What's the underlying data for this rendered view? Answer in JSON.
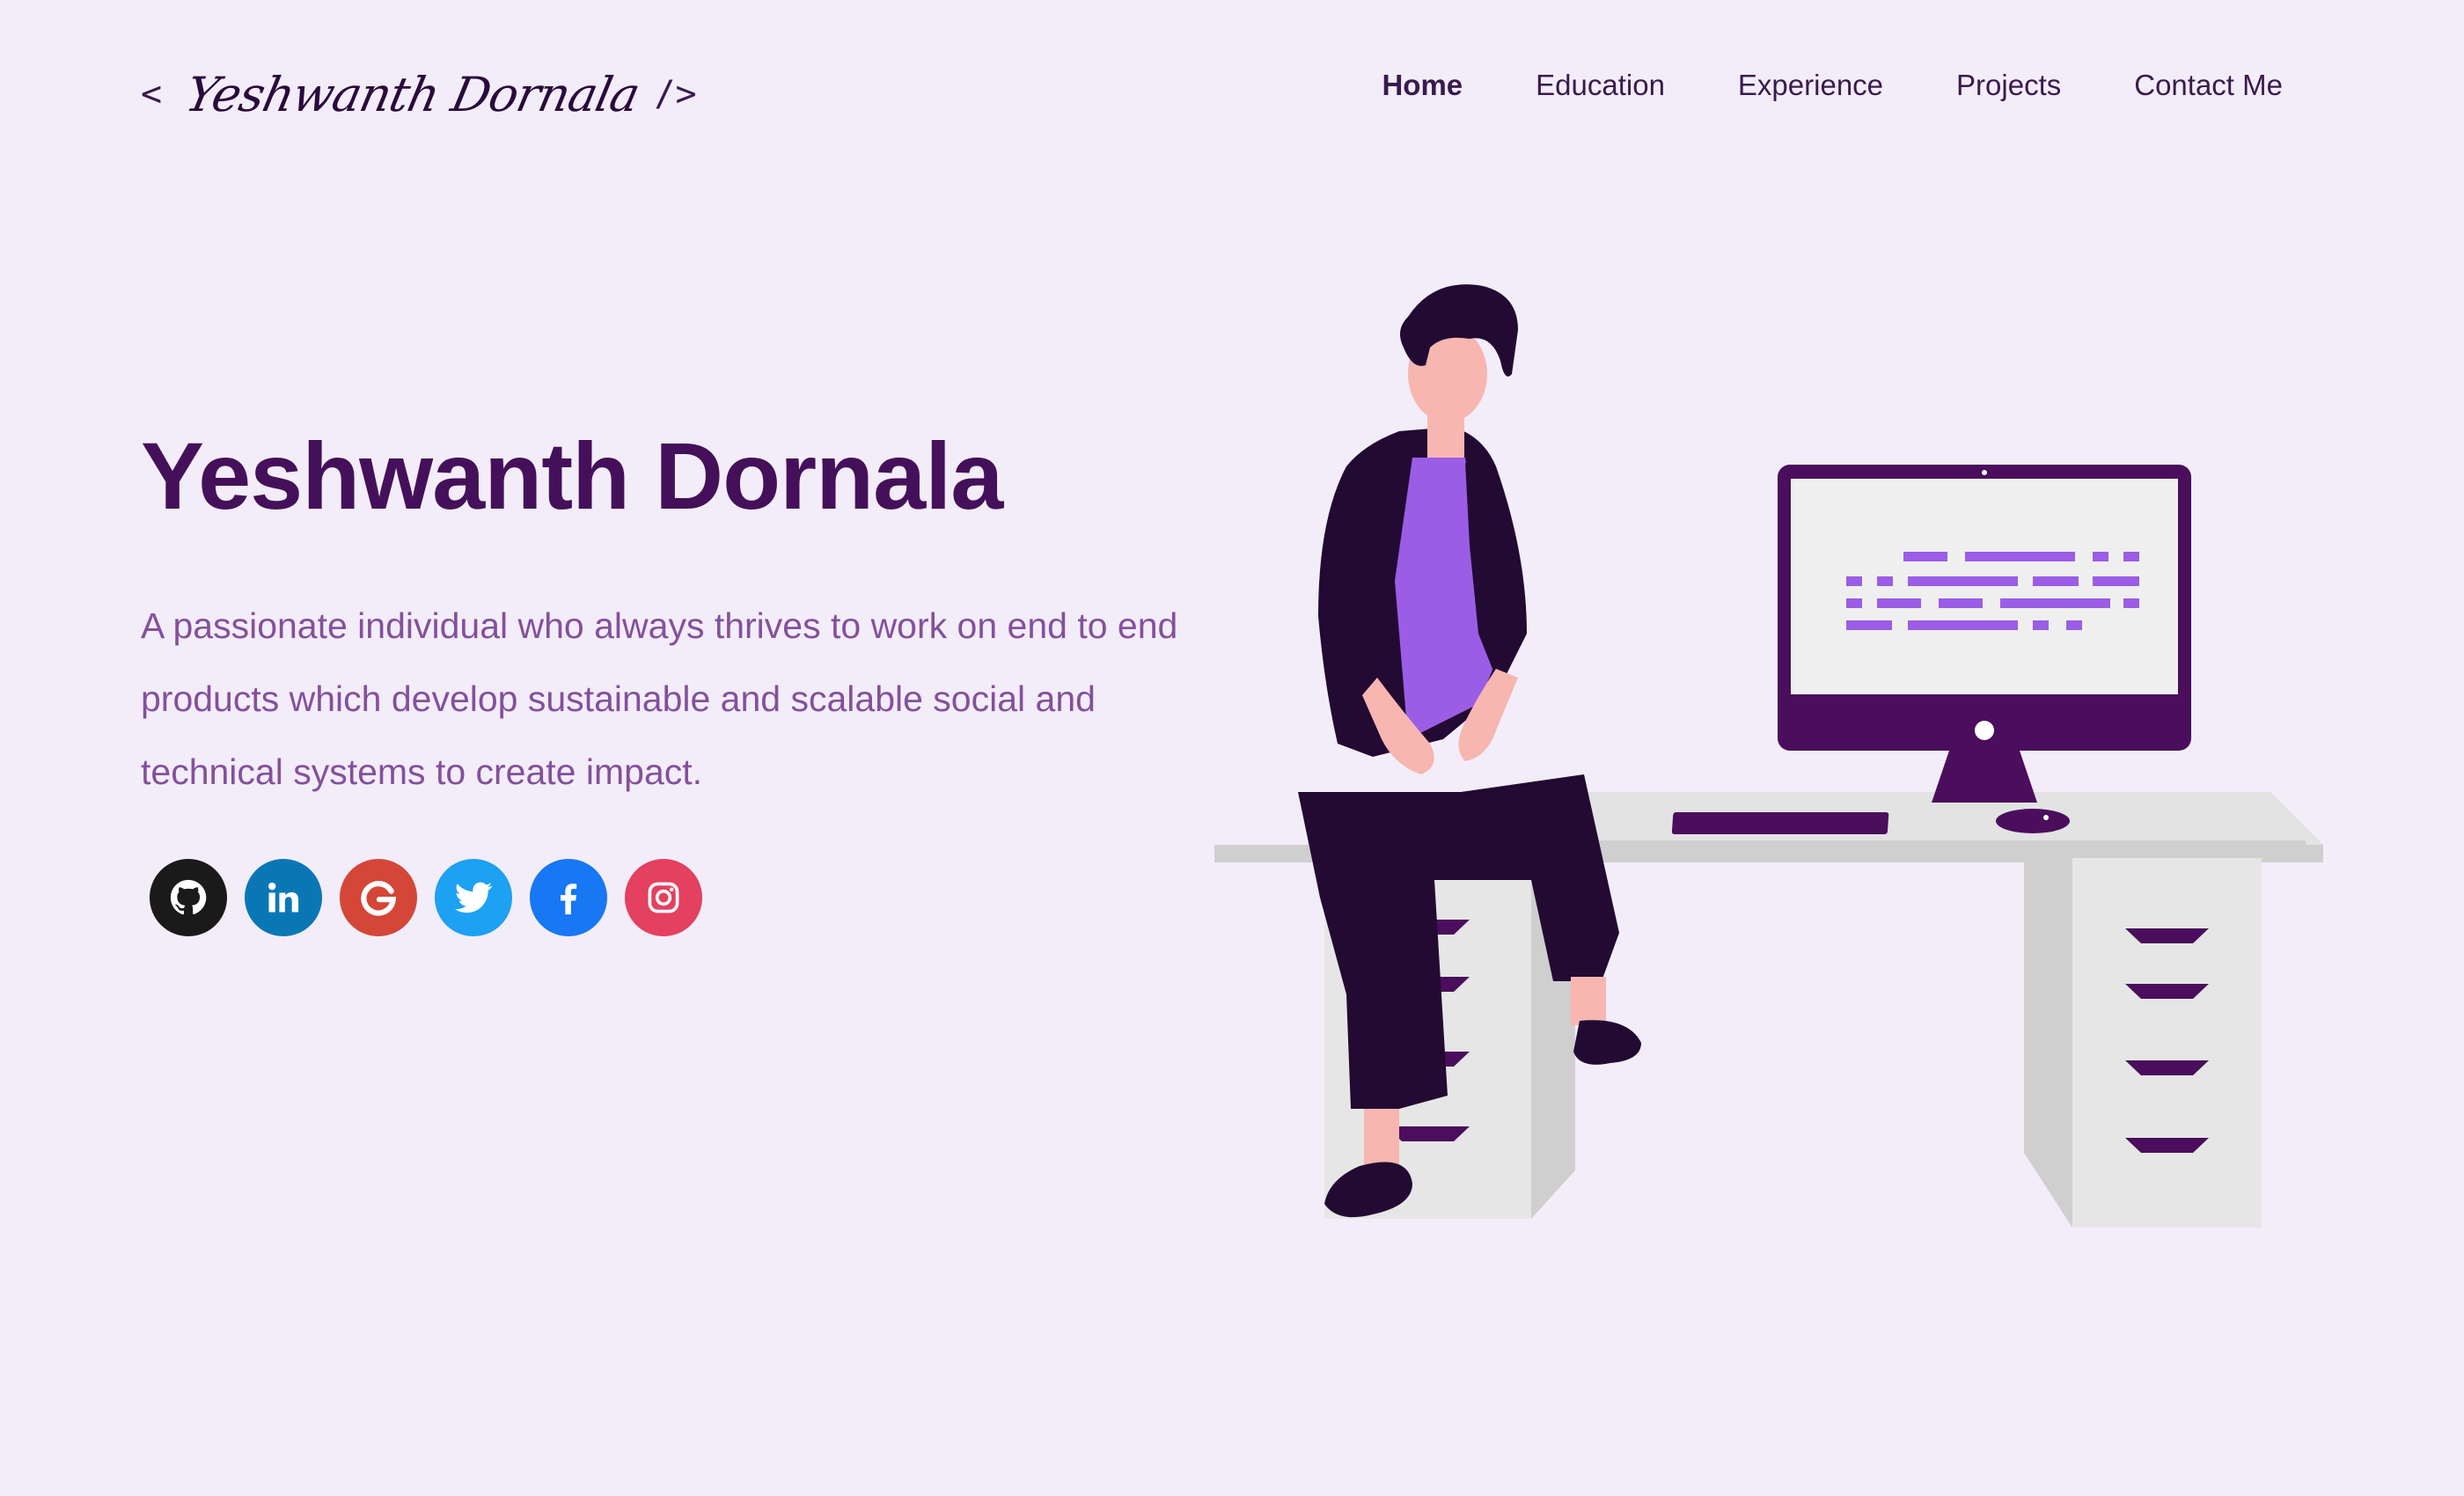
{
  "logo": {
    "open_bracket": "<",
    "name": "Yeshwanth Dornala",
    "close_bracket": "/>"
  },
  "nav": {
    "items": [
      "Home",
      "Education",
      "Experience",
      "Projects",
      "Contact Me"
    ],
    "active": "Home"
  },
  "hero": {
    "title": "Yeshwanth Dornala",
    "description": "A passionate individual who always thrives to work on end to end products which develop sustainable and scalable social and technical systems to create impact."
  },
  "socials": [
    {
      "name": "github-icon",
      "color": "#1a1a1a"
    },
    {
      "name": "linkedin-icon",
      "color": "#0a77b5"
    },
    {
      "name": "google-icon",
      "color": "#d44638"
    },
    {
      "name": "twitter-icon",
      "color": "#1da1f2"
    },
    {
      "name": "facebook-icon",
      "color": "#1877f2"
    },
    {
      "name": "instagram-icon",
      "color": "#e4405f"
    }
  ],
  "colors": {
    "background": "#f3edfa",
    "title": "#45105a",
    "description": "#84509c",
    "nav_text": "#3a1a4e",
    "accent_purple": "#9b5de5",
    "dark_purple": "#4a0e5c"
  }
}
